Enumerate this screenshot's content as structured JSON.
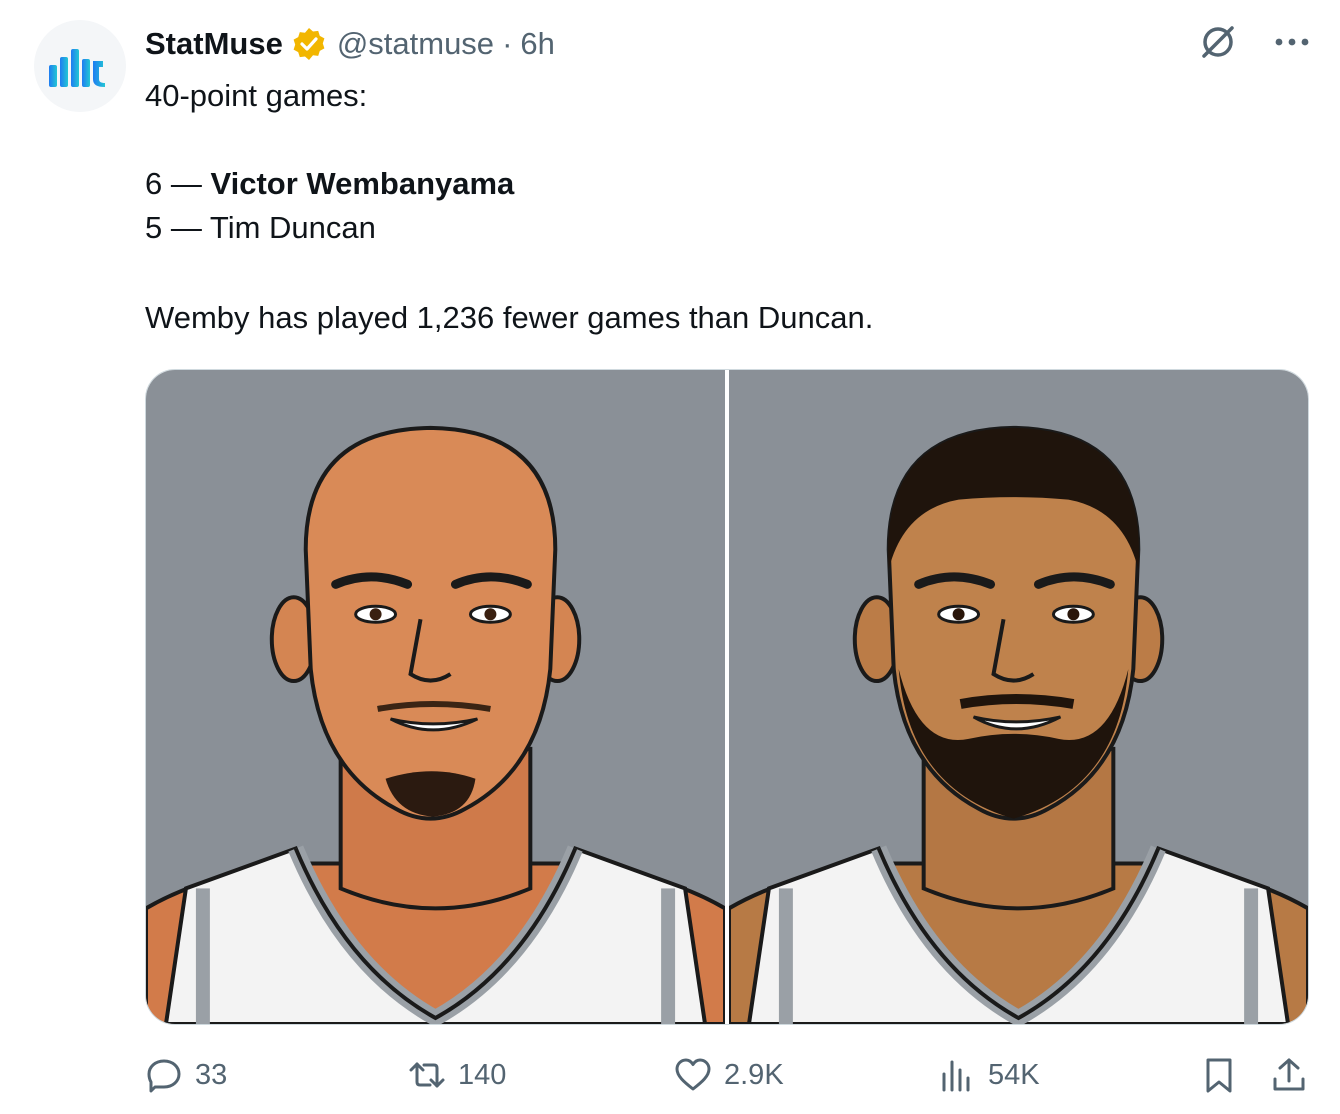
{
  "author": {
    "display_name": "StatMuse",
    "handle": "@statmuse",
    "separator": "·",
    "time": "6h",
    "avatar_icon": "statmuse-logo-icon",
    "verified_icon": "verified-badge-icon",
    "brand_color": "#1d9bf0"
  },
  "tweet": {
    "line1": "40-point games:",
    "rank1_count": "6",
    "rank1_dash": " — ",
    "rank1_name": "Victor Wembanyama",
    "rank2_count": "5",
    "rank2_dash": " — ",
    "rank2_name": "Tim Duncan",
    "footer": "Wemby has played 1,236 fewer games than Duncan."
  },
  "media": [
    {
      "icon": "victor-wembanyama-illustration"
    },
    {
      "icon": "tim-duncan-illustration"
    }
  ],
  "actions": {
    "replies": "33",
    "reposts": "140",
    "likes": "2.9K",
    "views": "54K"
  },
  "colors": {
    "text": "#0f1419",
    "muted": "#536471",
    "media_bg": "#8a9097",
    "verified": "#f2b600"
  }
}
